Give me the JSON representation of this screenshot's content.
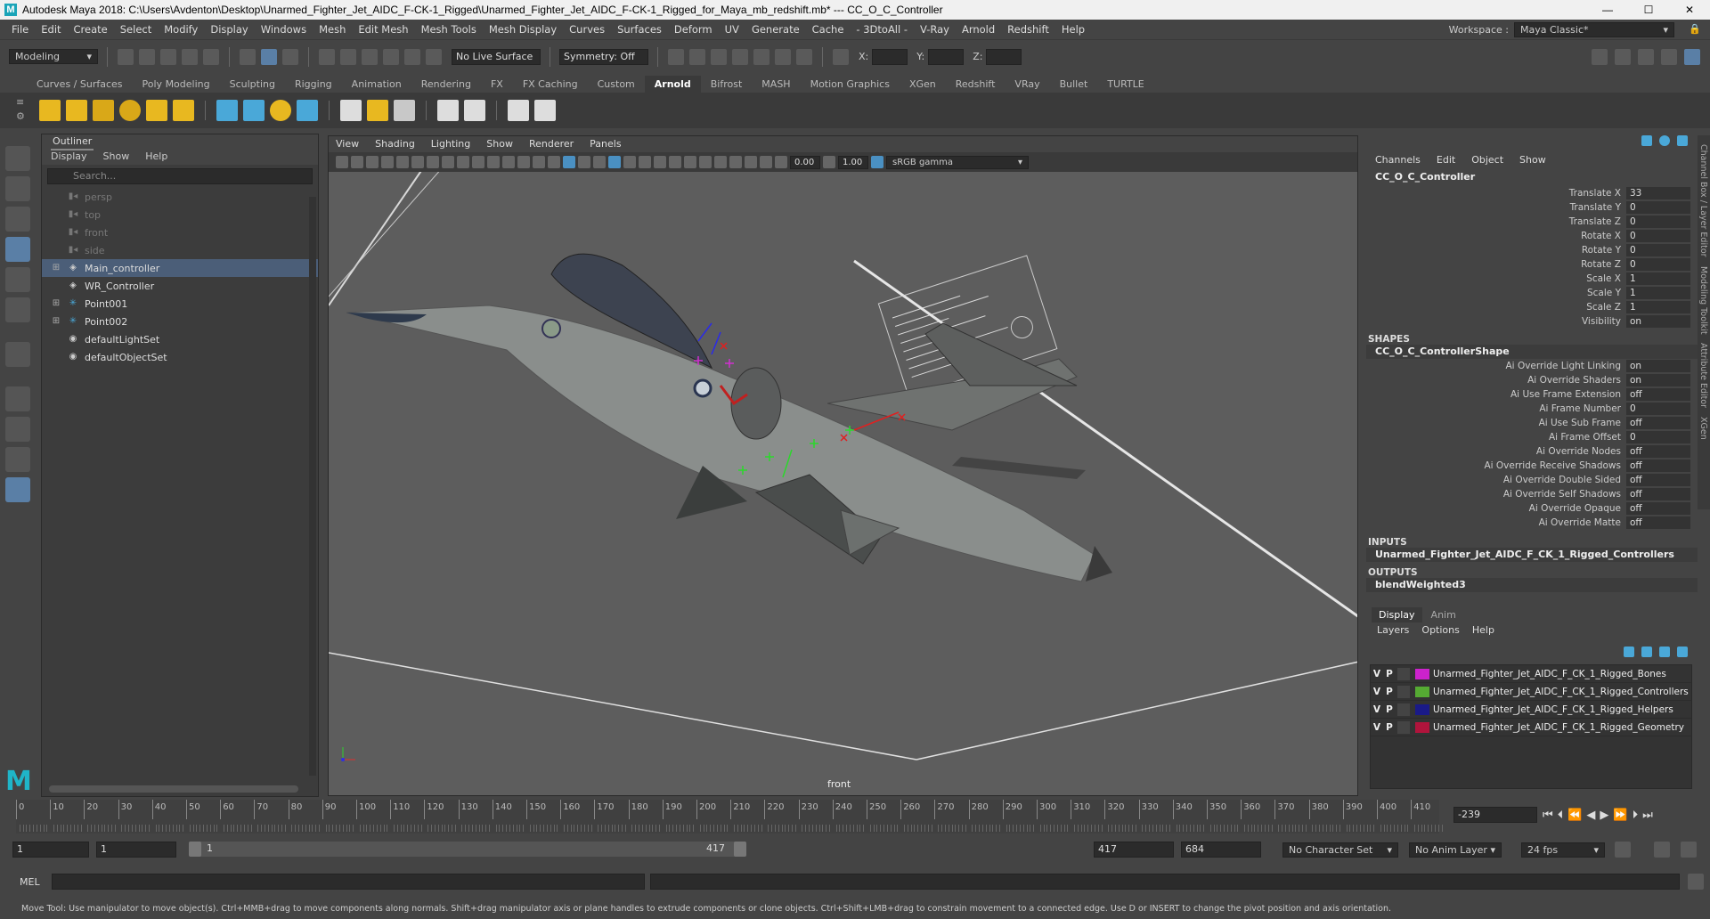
{
  "window": {
    "title": "Autodesk Maya 2018: C:\\Users\\Avdenton\\Desktop\\Unarmed_Fighter_Jet_AIDC_F-CK-1_Rigged\\Unarmed_Fighter_Jet_AIDC_F-CK-1_Rigged_for_Maya_mb_redshift.mb*   ---   CC_O_C_Controller",
    "minimize": "—",
    "maximize": "☐",
    "close": "✕"
  },
  "menubar": {
    "items": [
      "File",
      "Edit",
      "Create",
      "Select",
      "Modify",
      "Display",
      "Windows",
      "Mesh",
      "Edit Mesh",
      "Mesh Tools",
      "Mesh Display",
      "Curves",
      "Surfaces",
      "Deform",
      "UV",
      "Generate",
      "Cache",
      "- 3DtoAll -",
      "V-Ray",
      "Arnold",
      "Redshift",
      "Help"
    ],
    "workspace_label": "Workspace :",
    "workspace_value": "Maya Classic*"
  },
  "statusline": {
    "mode": "Modeling",
    "live_surface": "No Live Surface",
    "symmetry": "Symmetry: Off",
    "x_label": "X:",
    "y_label": "Y:",
    "z_label": "Z:"
  },
  "shelf": {
    "tabs": [
      "Curves / Surfaces",
      "Poly Modeling",
      "Sculpting",
      "Rigging",
      "Animation",
      "Rendering",
      "FX",
      "FX Caching",
      "Custom",
      "Arnold",
      "Bifrost",
      "MASH",
      "Motion Graphics",
      "XGen",
      "Redshift",
      "VRay",
      "Bullet",
      "TURTLE"
    ],
    "active_tab": "Arnold"
  },
  "outliner": {
    "title": "Outliner",
    "menu": [
      "Display",
      "Show",
      "Help"
    ],
    "search_placeholder": "Search...",
    "items": [
      {
        "label": "persp",
        "icon": "camera-icon",
        "dim": true,
        "expand": false
      },
      {
        "label": "top",
        "icon": "camera-icon",
        "dim": true,
        "expand": false
      },
      {
        "label": "front",
        "icon": "camera-icon",
        "dim": true,
        "expand": false
      },
      {
        "label": "side",
        "icon": "camera-icon",
        "dim": true,
        "expand": false
      },
      {
        "label": "Main_controller",
        "icon": "transform-icon",
        "dim": false,
        "expand": true,
        "selected": true
      },
      {
        "label": "WR_Controller",
        "icon": "transform-icon",
        "dim": false,
        "expand": false
      },
      {
        "label": "Point001",
        "icon": "point-icon",
        "dim": false,
        "expand": true
      },
      {
        "label": "Point002",
        "icon": "point-icon",
        "dim": false,
        "expand": true
      },
      {
        "label": "defaultLightSet",
        "icon": "set-icon",
        "dim": false,
        "expand": false
      },
      {
        "label": "defaultObjectSet",
        "icon": "set-icon",
        "dim": false,
        "expand": false
      }
    ]
  },
  "viewport": {
    "menu": [
      "View",
      "Shading",
      "Lighting",
      "Show",
      "Renderer",
      "Panels"
    ],
    "near_value": "0.00",
    "far_value": "1.00",
    "color_space": "sRGB gamma",
    "camera_label": "front"
  },
  "channelbox": {
    "menu": [
      "Channels",
      "Edit",
      "Object",
      "Show"
    ],
    "node_name": "CC_O_C_Controller",
    "attributes": [
      {
        "label": "Translate X",
        "value": "33"
      },
      {
        "label": "Translate Y",
        "value": "0"
      },
      {
        "label": "Translate Z",
        "value": "0"
      },
      {
        "label": "Rotate X",
        "value": "0"
      },
      {
        "label": "Rotate Y",
        "value": "0"
      },
      {
        "label": "Rotate Z",
        "value": "0"
      },
      {
        "label": "Scale X",
        "value": "1"
      },
      {
        "label": "Scale Y",
        "value": "1"
      },
      {
        "label": "Scale Z",
        "value": "1"
      },
      {
        "label": "Visibility",
        "value": "on"
      }
    ],
    "shapes_header": "SHAPES",
    "shape_name": "CC_O_C_ControllerShape",
    "shape_attributes": [
      {
        "label": "Ai Override Light Linking",
        "value": "on"
      },
      {
        "label": "Ai Override Shaders",
        "value": "on"
      },
      {
        "label": "Ai Use Frame Extension",
        "value": "off"
      },
      {
        "label": "Ai Frame Number",
        "value": "0"
      },
      {
        "label": "Ai Use Sub Frame",
        "value": "off"
      },
      {
        "label": "Ai Frame Offset",
        "value": "0"
      },
      {
        "label": "Ai Override Nodes",
        "value": "off"
      },
      {
        "label": "Ai Override Receive Shadows",
        "value": "off"
      },
      {
        "label": "Ai Override Double Sided",
        "value": "off"
      },
      {
        "label": "Ai Override Self Shadows",
        "value": "off"
      },
      {
        "label": "Ai Override Opaque",
        "value": "off"
      },
      {
        "label": "Ai Override Matte",
        "value": "off"
      }
    ],
    "inputs_header": "INPUTS",
    "input_name": "Unarmed_Fighter_Jet_AIDC_F_CK_1_Rigged_Controllers",
    "outputs_header": "OUTPUTS",
    "output_name": "blendWeighted3"
  },
  "layers": {
    "tabs": [
      "Display",
      "Anim"
    ],
    "menu": [
      "Layers",
      "Options",
      "Help"
    ],
    "rows": [
      {
        "v": "V",
        "p": "P",
        "color": "#cc22cc",
        "name": "Unarmed_Fighter_Jet_AIDC_F_CK_1_Rigged_Bones"
      },
      {
        "v": "V",
        "p": "P",
        "color": "#55aa33",
        "name": "Unarmed_Fighter_Jet_AIDC_F_CK_1_Rigged_Controllers"
      },
      {
        "v": "V",
        "p": "P",
        "color": "#1a1a88",
        "name": "Unarmed_Fighter_Jet_AIDC_F_CK_1_Rigged_Helpers"
      },
      {
        "v": "V",
        "p": "P",
        "color": "#b0143c",
        "name": "Unarmed_Fighter_Jet_AIDC_F_CK_1_Rigged_Geometry"
      }
    ]
  },
  "rightstrip": [
    "Channel Box / Layer Editor",
    "Modeling Toolkit",
    "Attribute Editor",
    "XGen"
  ],
  "timeline": {
    "ticks": [
      "0",
      "10",
      "20",
      "30",
      "40",
      "50",
      "60",
      "70",
      "80",
      "90",
      "100",
      "110",
      "120",
      "130",
      "140",
      "150",
      "160",
      "170",
      "180",
      "190",
      "200",
      "210",
      "220",
      "230",
      "240",
      "250",
      "260",
      "270",
      "280",
      "290",
      "300",
      "310",
      "320",
      "330",
      "340",
      "350",
      "360",
      "370",
      "380",
      "390",
      "400",
      "410"
    ],
    "current_frame": "-239"
  },
  "range": {
    "start": "1",
    "playback_start": "1",
    "slider_start": "1",
    "slider_end": "417",
    "playback_end": "417",
    "end": "684",
    "character_set": "No Character Set",
    "anim_layer": "No Anim Layer",
    "fps": "24 fps"
  },
  "cmdline": {
    "label": "MEL"
  },
  "helpline": {
    "text": "Move Tool: Use manipulator to move object(s). Ctrl+MMB+drag to move components along normals. Shift+drag manipulator axis or plane handles to extrude components or clone objects. Ctrl+Shift+LMB+drag to constrain movement to a connected edge. Use D or INSERT to change the pivot position and axis orientation."
  }
}
